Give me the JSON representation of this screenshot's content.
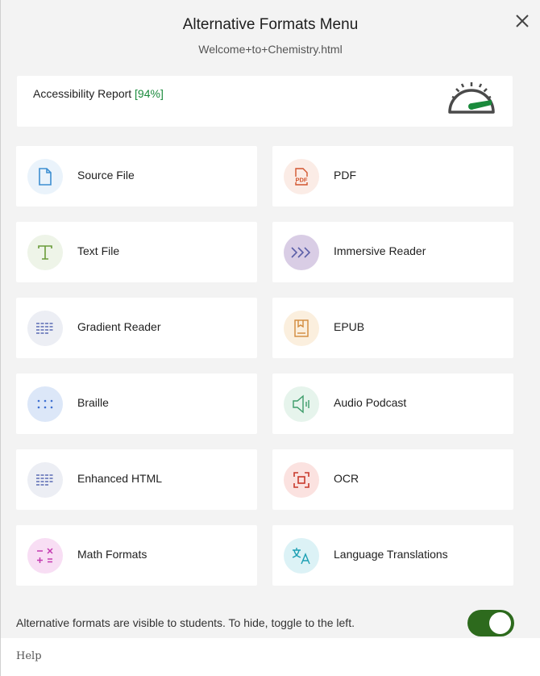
{
  "header": {
    "title": "Alternative Formats Menu",
    "subtitle": "Welcome+to+Chemistry.html"
  },
  "report": {
    "label": "Accessibility Report",
    "score": "[94%]",
    "score_value_percent": 94
  },
  "formats": [
    {
      "label": "Source File",
      "icon": "document-icon",
      "color": "#eaf3fb"
    },
    {
      "label": "PDF",
      "icon": "pdf-icon",
      "color": "#fbece6"
    },
    {
      "label": "Text File",
      "icon": "text-t-icon",
      "color": "#eef4e8"
    },
    {
      "label": "Immersive Reader",
      "icon": "chevrons-right-icon",
      "color": "#d9cde5"
    },
    {
      "label": "Gradient Reader",
      "icon": "gradient-lines-icon",
      "color": "#eceef4"
    },
    {
      "label": "EPUB",
      "icon": "book-icon",
      "color": "#fbefde"
    },
    {
      "label": "Braille",
      "icon": "braille-dots-icon",
      "color": "#dce7f8"
    },
    {
      "label": "Audio Podcast",
      "icon": "speaker-icon",
      "color": "#e6f4ec"
    },
    {
      "label": "Enhanced HTML",
      "icon": "html-lines-icon",
      "color": "#eceef4"
    },
    {
      "label": "OCR",
      "icon": "scan-icon",
      "color": "#fbe2e0"
    },
    {
      "label": "Math Formats",
      "icon": "math-symbols-icon",
      "color": "#f8def4"
    },
    {
      "label": "Language Translations",
      "icon": "translate-icon",
      "color": "#dcf2f6"
    }
  ],
  "footer": {
    "visibility_text": "Alternative formats are visible to students. To hide, toggle to the left.",
    "toggle_on": true,
    "help": "Help"
  },
  "colors": {
    "accent_green": "#2d6a1d",
    "score_green": "#1a8a3c"
  }
}
